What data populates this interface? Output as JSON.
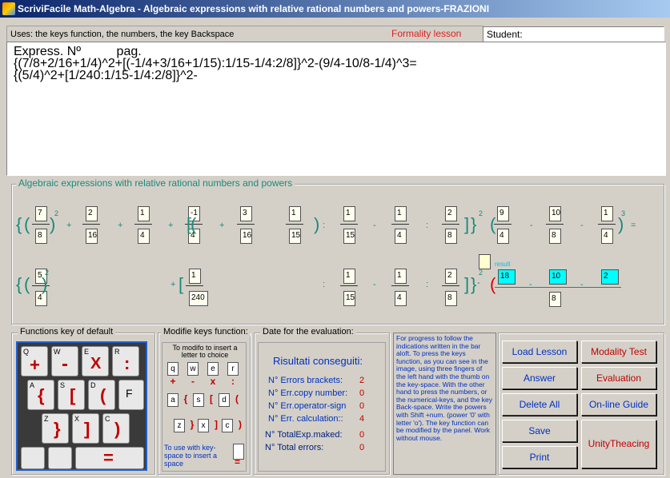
{
  "window": {
    "title": "ScriviFacile Math-Algebra - Algebraic expressions with relative rational numbers and powers-FRAZIONI"
  },
  "topbar": {
    "uses": "Uses: the keys function, the numbers, the key Backspace",
    "lesson": "Formality lesson",
    "student": "Student:"
  },
  "editor": {
    "text": "Express. Nº          pag.\n{(7/8+2/16+1/4)^2+[(-1/4+3/16+1/15):1/15-1/4:2/8]}^2-(9/4-10/8-1/4)^3=\n{(5/4)^2+[1/240:1/15-1/4:2/8]}^2-"
  },
  "expr": {
    "title": "Algebraic expressions with relative rational numbers and powers",
    "row1": [
      "7",
      "8",
      "2",
      "16",
      "1",
      "4",
      "-1",
      "4",
      "3",
      "16",
      "1",
      "15",
      "1",
      "15",
      "1",
      "4",
      "2",
      "8",
      "9",
      "4",
      "10",
      "8",
      "1",
      "4"
    ],
    "row1_ops": [
      "+",
      "+",
      "+",
      "+",
      ":",
      "-",
      ":",
      "-",
      "-",
      "="
    ],
    "exp": [
      "2",
      "2",
      "3",
      "2",
      "2"
    ],
    "row2": [
      "5",
      "4",
      "1",
      "240",
      "1",
      "15",
      "1",
      "4",
      "2",
      "8",
      "8"
    ],
    "row2_ops": [
      "+",
      ":",
      "-",
      ":",
      "-",
      "-"
    ],
    "cyan": [
      "18",
      "10",
      "2"
    ],
    "result_label": "result"
  },
  "functions_key": {
    "title": "Functions key of default",
    "keys": [
      "Q",
      "W",
      "E",
      "R",
      "A",
      "S",
      "D",
      "F",
      "Z",
      "X",
      "C"
    ]
  },
  "modify": {
    "title": "Modifie keys function:",
    "hint": "To modifo to insert a letter to choice",
    "row1": [
      "q",
      "w",
      "e",
      "r"
    ],
    "row1s": [
      "+",
      "-",
      "x",
      ":"
    ],
    "row2": [
      "a",
      "s",
      "d"
    ],
    "row2s": [
      "{",
      "[",
      "("
    ],
    "row3": [
      "z",
      "x",
      "c"
    ],
    "row3s": [
      "}",
      "]",
      ")"
    ],
    "space_hint": "To use with key-space to insert a space"
  },
  "evaluation": {
    "title": "Date for the evaluation:",
    "heading": "Risultati conseguiti:",
    "rows": [
      {
        "label": "N° Errors brackets:",
        "value": "2"
      },
      {
        "label": "N° Err.copy number:",
        "value": "0"
      },
      {
        "label": "N° Err.operator-sign",
        "value": "0"
      },
      {
        "label": "N° Err. calculation::",
        "value": "4"
      }
    ],
    "rows2": [
      {
        "label": "N° TotalExp.maked:",
        "value": "0"
      },
      {
        "label": "N° Total errors:",
        "value": "0"
      }
    ]
  },
  "help": {
    "text": "For progress to follow the indications written in the bar aloft. To press the keys function, as you can see in the image, using three fingers of the left hand with the thumb on the key-space. With the other hand to press the numbers, or the numerical-keys, and the key Back-space. Write the powers with Shift +num. (power '0' with letter 'o'). The key function can be modified by the panel. Work without mouse."
  },
  "buttons": {
    "load": "Load Lesson",
    "modality": "Modality Test",
    "answer": "Answer",
    "evaluation": "Evaluation",
    "delete": "Delete All",
    "guide": "On-line Guide",
    "save": "Save",
    "print": "Print",
    "unity": "UnityTheacing"
  }
}
